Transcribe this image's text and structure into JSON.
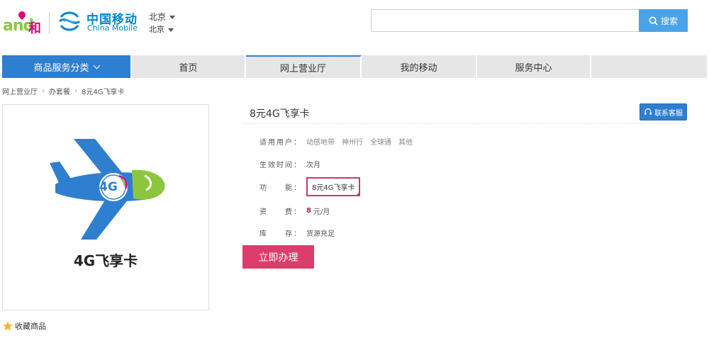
{
  "header": {
    "logo_and": "and",
    "logo_he": "和",
    "brand_cn": "中国移动",
    "brand_en": "China Mobile",
    "city_primary": "北京",
    "city_secondary": "北京",
    "search": {
      "value": "",
      "placeholder": "",
      "button_label": "搜索"
    }
  },
  "nav": {
    "category_label": "商品服务分类",
    "items": [
      {
        "label": "首页",
        "active": false
      },
      {
        "label": "网上营业厅",
        "active": true
      },
      {
        "label": "我的移动",
        "active": false
      },
      {
        "label": "服务中心",
        "active": false
      }
    ]
  },
  "breadcrumb": [
    "网上营业厅",
    "办套餐",
    "8元4G飞享卡"
  ],
  "product": {
    "image_caption": "4G飞享卡",
    "badge_text": "4G",
    "title": "8元4G飞享卡",
    "contact_label": "联系客服",
    "attributes": {
      "users_label": "适用用户：",
      "users_values": [
        "动感地带",
        "神州行",
        "全球通",
        "其他"
      ],
      "effective_label": "生效时间：",
      "effective_value": "次月",
      "feature_label": "功　　能：",
      "feature_value": "8元4G飞享卡",
      "fee_label": "资　　费：",
      "fee_number": "8",
      "fee_unit": "元/月",
      "stock_label": "库　　存：",
      "stock_value": "货源充足"
    },
    "buy_label": "立即办理",
    "favorite_label": "收藏商品"
  },
  "colors": {
    "brand_blue": "#0086d1",
    "nav_blue": "#2f7fd0",
    "search_blue": "#4aa3e6",
    "buy_pink": "#dc3d6c",
    "and_green": "#8cc63f",
    "and_magenta": "#e2007a"
  }
}
